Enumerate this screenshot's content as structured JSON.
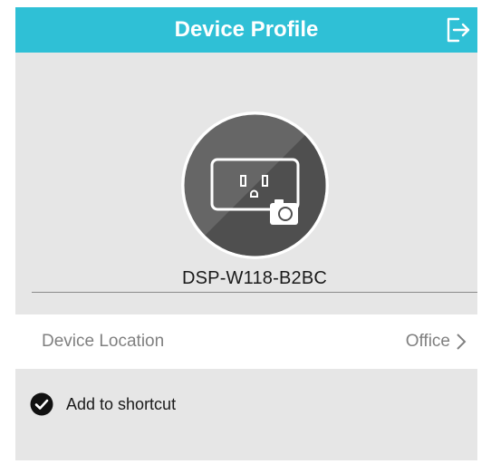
{
  "header": {
    "title": "Device Profile",
    "logout_icon": "logout-icon"
  },
  "profile": {
    "device_name": "DSP-W118-B2BC",
    "avatar_icon": "smart-plug-icon",
    "camera_icon": "camera-icon"
  },
  "location": {
    "label": "Device Location",
    "value": "Office",
    "chevron_icon": "chevron-right-icon"
  },
  "shortcut": {
    "label": "Add to shortcut",
    "checked": true,
    "check_icon": "check-circle-icon"
  },
  "colors": {
    "header": "#2fc0d6",
    "background": "#e6e6e6",
    "row": "#ffffff",
    "muted_text": "#808080"
  }
}
